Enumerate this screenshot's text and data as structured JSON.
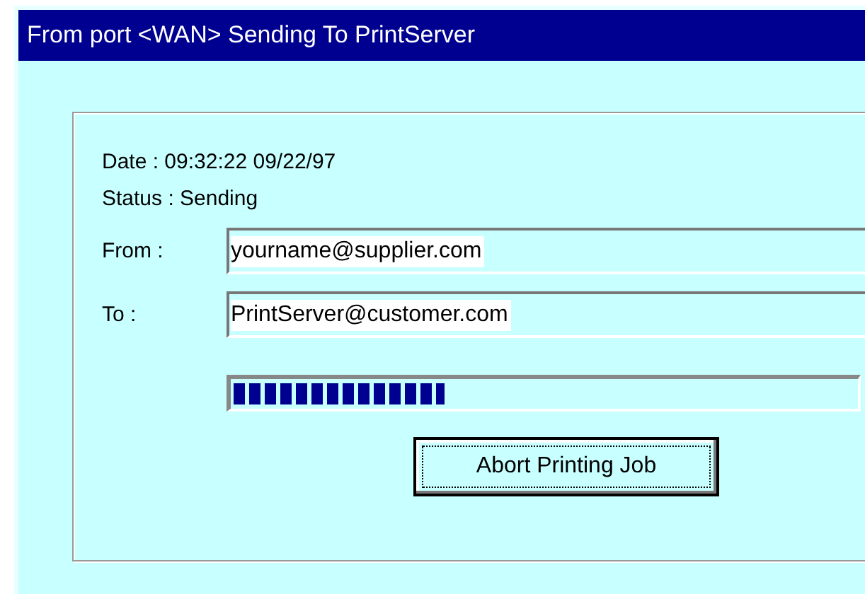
{
  "window": {
    "title": "From port <WAN> Sending To PrintServer"
  },
  "info": [
    {
      "text": "Date : 09:32:22 09/22/97"
    },
    {
      "text": "Status : Sending"
    }
  ],
  "fields": [
    {
      "label": "From :",
      "value": "yourname@supplier.com"
    },
    {
      "label": "To :",
      "value": "PrintServer@customer.com"
    }
  ],
  "progress": {
    "level": 0.34
  },
  "button": {
    "label": "Abort Printing Job"
  }
}
